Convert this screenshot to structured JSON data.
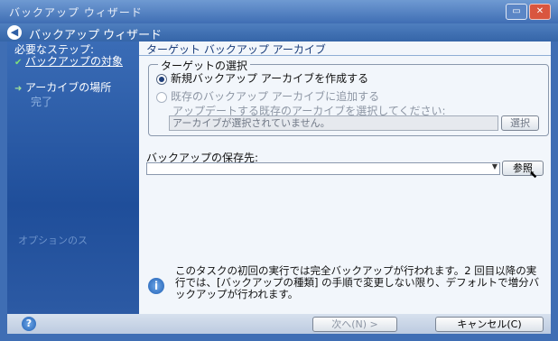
{
  "window": {
    "title": "バックアップ ウィザード",
    "minimize_icon": "minimize-icon",
    "close_icon": "close-icon"
  },
  "header": {
    "title": "バックアップ ウィザード",
    "back_icon": "back-arrow-icon"
  },
  "sidebar": {
    "heading": "必要なステップ:",
    "steps": [
      {
        "label": "バックアップの対象",
        "state": "done"
      },
      {
        "label": "アーカイブの場所",
        "state": "current"
      },
      {
        "label": "完了",
        "state": "pending"
      }
    ],
    "optional": "オプションのス"
  },
  "main": {
    "title": "ターゲット バックアップ アーカイブ",
    "target_group": {
      "legend": "ターゲットの選択",
      "option_new": "新規バックアップ アーカイブを作成する",
      "option_existing": "既存のバックアップ アーカイブに追加する",
      "hint": "アップデートする既存のアーカイブを選択してください:",
      "archive_value": "アーカイブが選択されていません。",
      "select_label": "選択"
    },
    "destination": {
      "label": "バックアップの保存先:",
      "value": "",
      "browse_label": "参照"
    },
    "info": "このタスクの初回の実行では完全バックアップが行われます。2 回目以降の実行では、[バックアップの種類] の手順で変更しない限り、デフォルトで増分バックアップが行われます。"
  },
  "footer": {
    "next_label": "次へ(N) >",
    "cancel_label": "キャンセル(C)"
  },
  "colors": {
    "accent": "#3f6eb4",
    "sidebar": "#1f4e9a",
    "panel": "#f2f6fb"
  }
}
